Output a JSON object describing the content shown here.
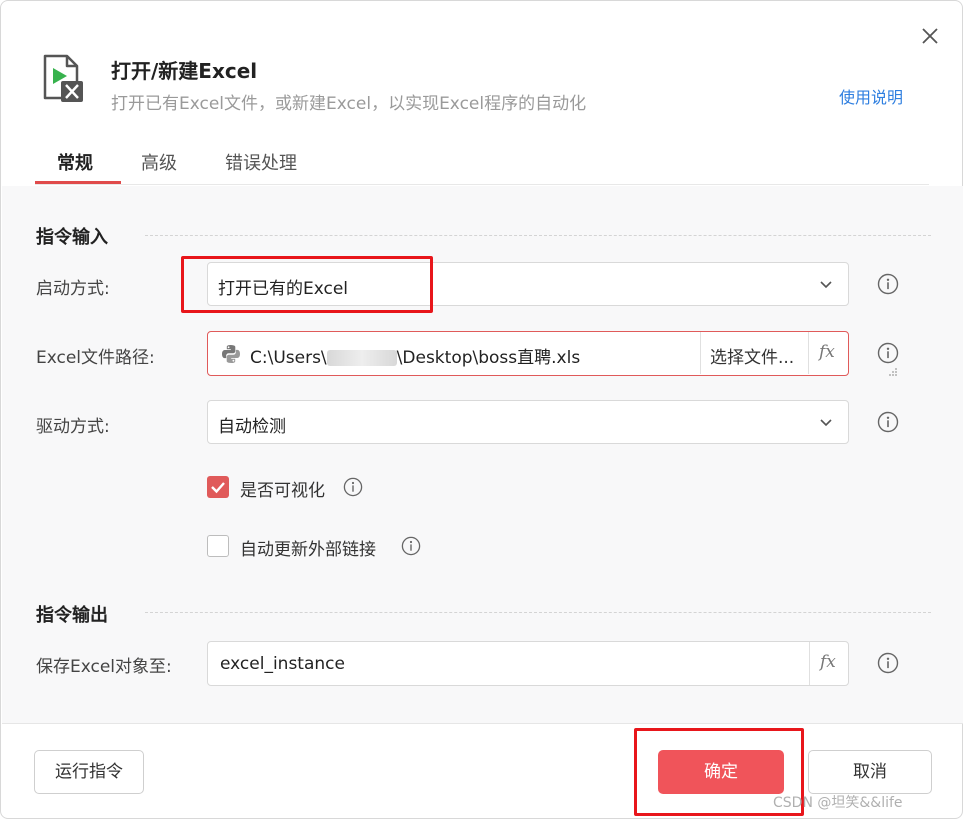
{
  "header": {
    "title": "打开/新建Excel",
    "subtitle": "打开已有Excel文件，或新建Excel，以实现Excel程序的自动化",
    "help_link": "使用说明",
    "icon": "excel-file-icon",
    "close_icon": "close-icon"
  },
  "tabs": [
    {
      "label": "常规",
      "active": true
    },
    {
      "label": "高级",
      "active": false
    },
    {
      "label": "错误处理",
      "active": false
    }
  ],
  "input_section": {
    "title": "指令输入",
    "launch_mode": {
      "label": "启动方式:",
      "value": "打开已有的Excel"
    },
    "file_path": {
      "label": "Excel文件路径:",
      "value_prefix": "C:\\Users\\",
      "value_suffix": "\\Desktop\\boss直聘.xls",
      "choose_button": "选择文件...",
      "fx": "fx"
    },
    "driver_mode": {
      "label": "驱动方式:",
      "value": "自动检测"
    },
    "visible_checkbox": {
      "label": "是否可视化",
      "checked": true
    },
    "auto_update_checkbox": {
      "label": "自动更新外部链接",
      "checked": false
    }
  },
  "output_section": {
    "title": "指令输出",
    "save_to": {
      "label": "保存Excel对象至:",
      "value": "excel_instance",
      "fx": "fx"
    }
  },
  "footer": {
    "run_button": "运行指令",
    "ok_button": "确定",
    "cancel_button": "取消"
  },
  "watermark": "CSDN @坦笑&&life",
  "colors": {
    "accent": "#e04b4b",
    "primary_button": "#f0545a",
    "link": "#2f7fe0",
    "highlight": "#e8161b"
  }
}
